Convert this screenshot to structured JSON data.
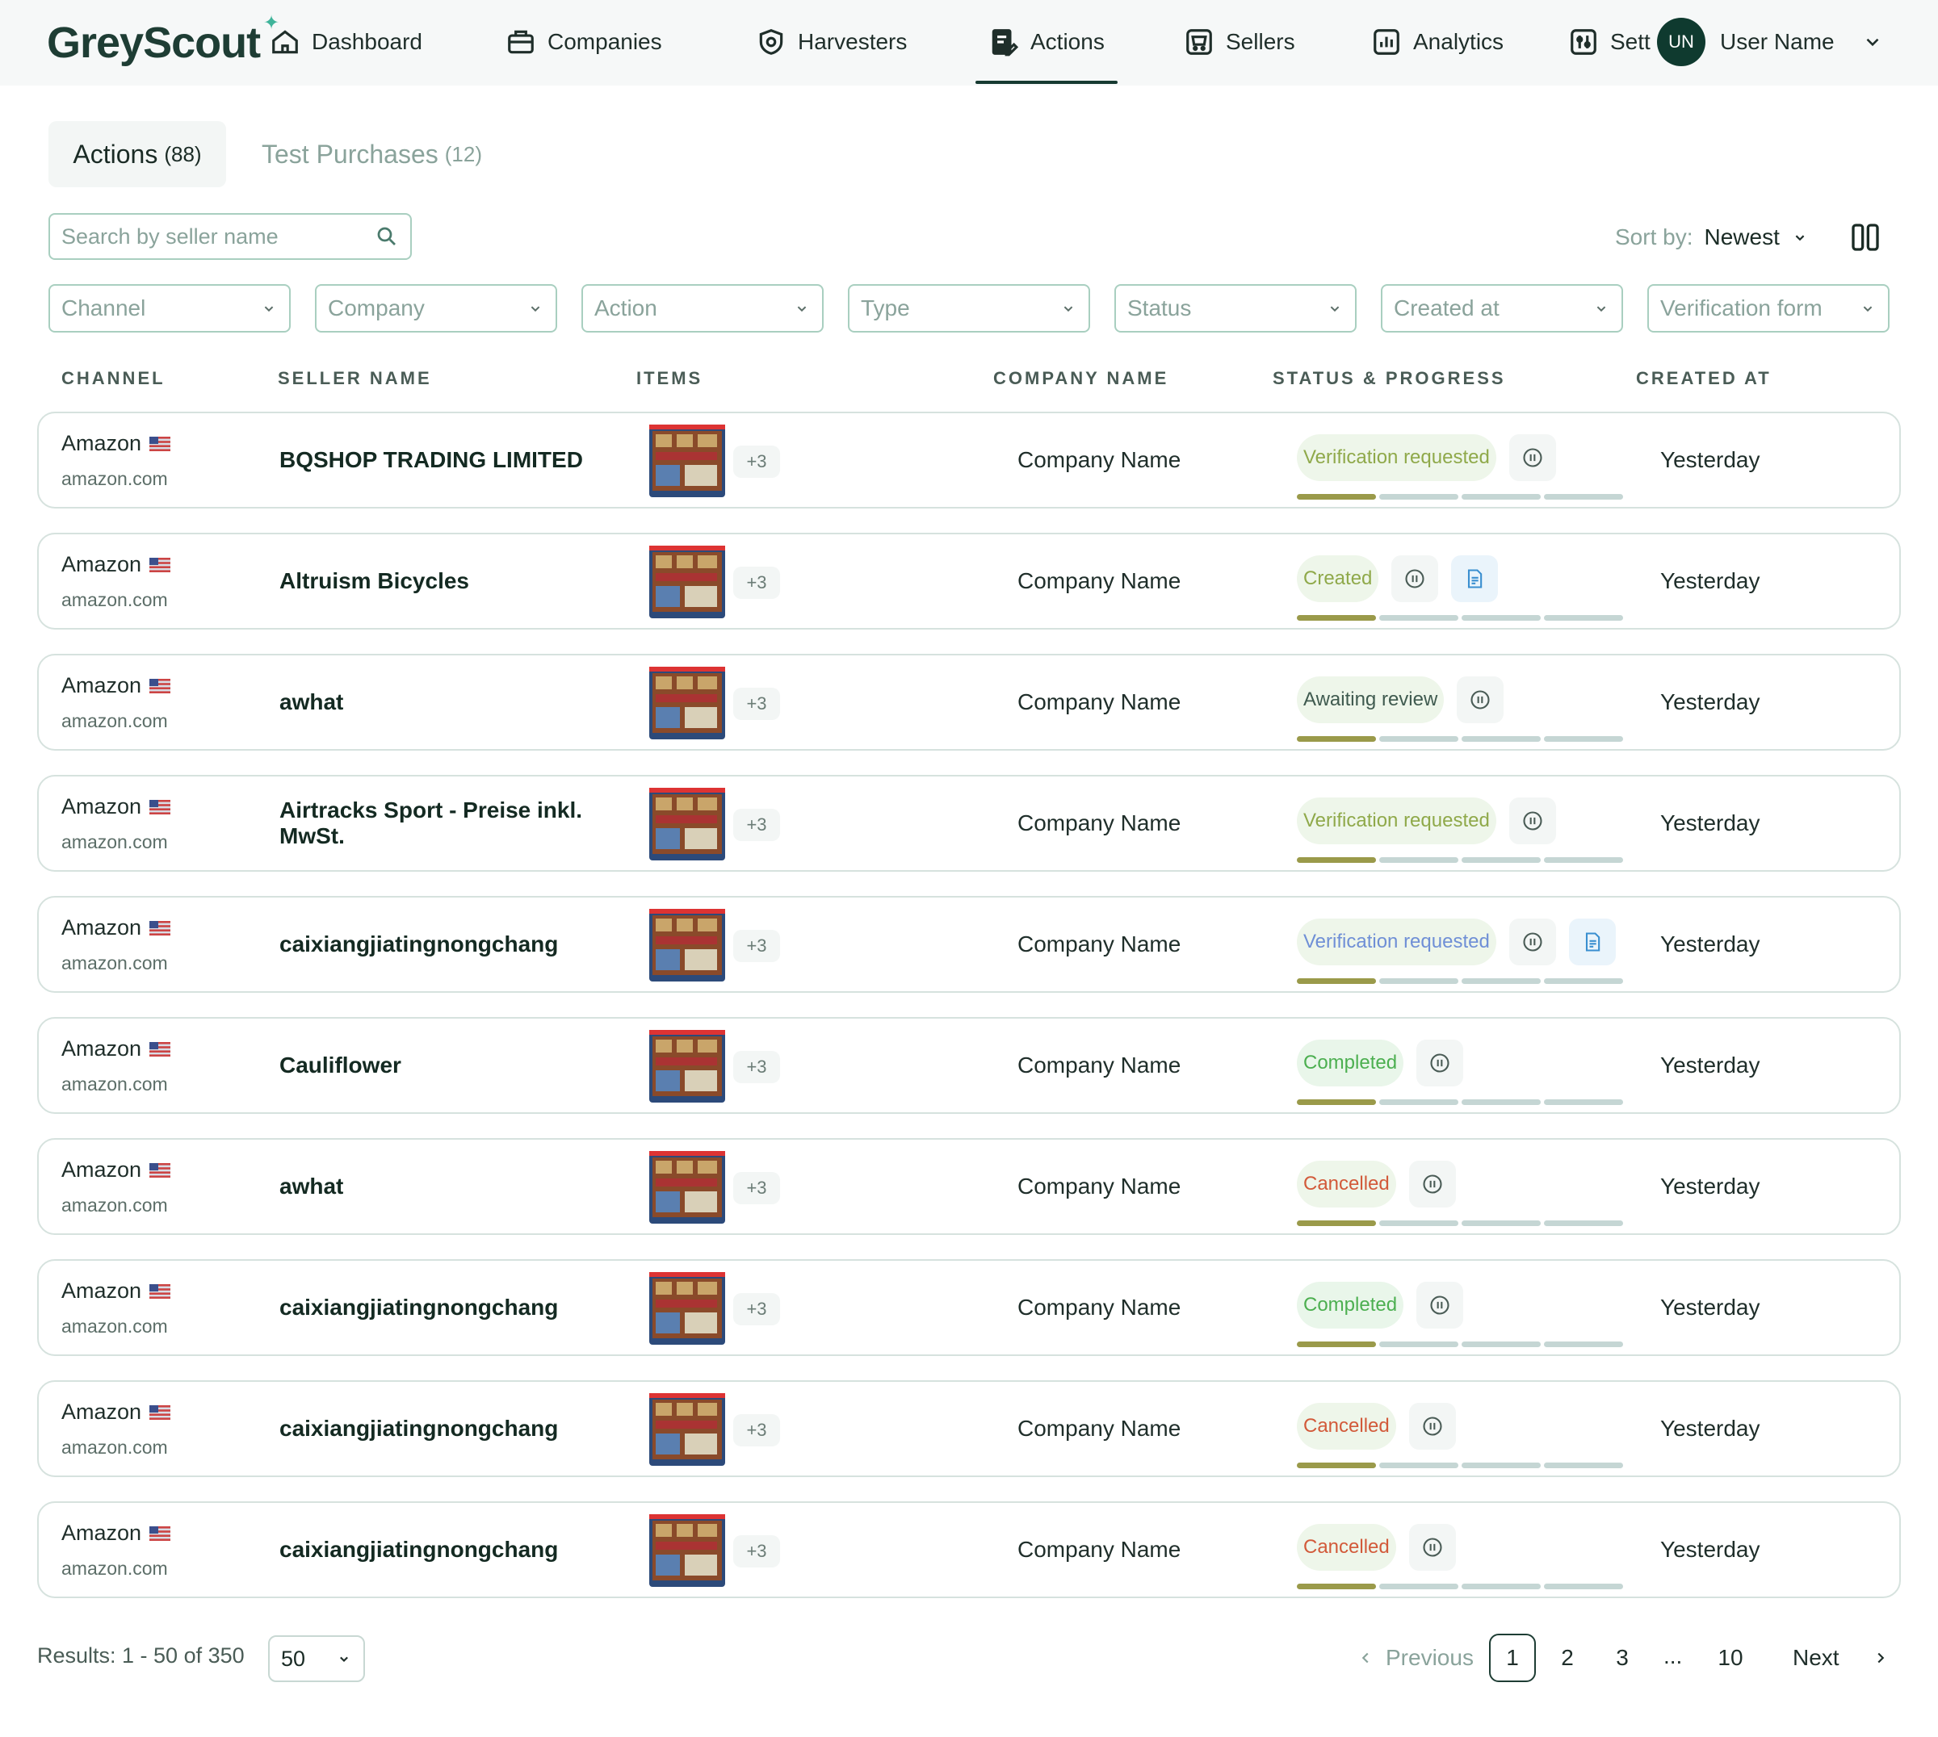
{
  "app": {
    "logo": "GreyScout",
    "nav": [
      {
        "label": "Dashboard",
        "icon": "home-icon"
      },
      {
        "label": "Companies",
        "icon": "briefcase-icon"
      },
      {
        "label": "Harvesters",
        "icon": "shield-gear-icon"
      },
      {
        "label": "Actions",
        "icon": "document-edit-icon",
        "active": true
      },
      {
        "label": "Sellers",
        "icon": "cart-icon"
      },
      {
        "label": "Analytics",
        "icon": "bar-chart-icon"
      },
      {
        "label": "Sett",
        "icon": "sliders-icon"
      }
    ],
    "user": {
      "initials": "UN",
      "name": "User Name"
    }
  },
  "tabs": [
    {
      "label": "Actions",
      "count": "(88)",
      "active": true
    },
    {
      "label": "Test Purchases",
      "count": "(12)",
      "active": false
    }
  ],
  "search": {
    "placeholder": "Search by seller name"
  },
  "sort": {
    "label": "Sort by:",
    "value": "Newest"
  },
  "filters": [
    "Channel",
    "Company",
    "Action",
    "Type",
    "Status",
    "Created at",
    "Verification form"
  ],
  "columns": [
    "CHANNEL",
    "SELLER NAME",
    "ITEMS",
    "COMPANY NAME",
    "STATUS & PROGRESS",
    "CREATED AT"
  ],
  "rows": [
    {
      "channel": "Amazon",
      "domain": "amazon.com",
      "seller": "BQSHOP TRADING LIMITED",
      "more": "+3",
      "company": "Company Name",
      "status": "Verification requested",
      "status_tone": "green",
      "has_doc": false,
      "progress": 0.25,
      "created": "Yesterday"
    },
    {
      "channel": "Amazon",
      "domain": "amazon.com",
      "seller": "Altruism Bicycles",
      "more": "+3",
      "company": "Company Name",
      "status": "Created",
      "status_tone": "green",
      "has_doc": true,
      "progress": 0.25,
      "created": "Yesterday"
    },
    {
      "channel": "Amazon",
      "domain": "amazon.com",
      "seller": "awhat",
      "more": "+3",
      "company": "Company Name",
      "status": "Awaiting review",
      "status_tone": "dark",
      "has_doc": false,
      "progress": 0.25,
      "created": "Yesterday"
    },
    {
      "channel": "Amazon",
      "domain": "amazon.com",
      "seller": "Airtracks Sport - Preise inkl. MwSt.",
      "more": "+3",
      "company": "Company Name",
      "status": "Verification requested",
      "status_tone": "green",
      "has_doc": false,
      "progress": 0.25,
      "created": "Yesterday"
    },
    {
      "channel": "Amazon",
      "domain": "amazon.com",
      "seller": "caixiangjiatingnongchang",
      "more": "+3",
      "company": "Company Name",
      "status": "Verification requested",
      "status_tone": "blue",
      "has_doc": true,
      "progress": 0.25,
      "created": "Yesterday"
    },
    {
      "channel": "Amazon",
      "domain": "amazon.com",
      "seller": "Cauliflower",
      "more": "+3",
      "company": "Company Name",
      "status": "Completed",
      "status_tone": "greenok",
      "has_doc": false,
      "progress": 0.25,
      "created": "Yesterday"
    },
    {
      "channel": "Amazon",
      "domain": "amazon.com",
      "seller": "awhat",
      "more": "+3",
      "company": "Company Name",
      "status": "Cancelled",
      "status_tone": "red",
      "has_doc": false,
      "progress": 0.25,
      "created": "Yesterday"
    },
    {
      "channel": "Amazon",
      "domain": "amazon.com",
      "seller": "caixiangjiatingnongchang",
      "more": "+3",
      "company": "Company Name",
      "status": "Completed",
      "status_tone": "greenok",
      "has_doc": false,
      "progress": 0.25,
      "created": "Yesterday"
    },
    {
      "channel": "Amazon",
      "domain": "amazon.com",
      "seller": "caixiangjiatingnongchang",
      "more": "+3",
      "company": "Company Name",
      "status": "Cancelled",
      "status_tone": "red",
      "has_doc": false,
      "progress": 0.25,
      "created": "Yesterday"
    },
    {
      "channel": "Amazon",
      "domain": "amazon.com",
      "seller": "caixiangjiatingnongchang",
      "more": "+3",
      "company": "Company Name",
      "status": "Cancelled",
      "status_tone": "red",
      "has_doc": false,
      "progress": 0.25,
      "created": "Yesterday"
    }
  ],
  "footer": {
    "results": "Results: 1 - 50 of 350",
    "per_page": "50",
    "prev": "Previous",
    "next": "Next",
    "pages": [
      "1",
      "2",
      "3",
      "10"
    ],
    "ellipsis": "...",
    "current_page": "1"
  },
  "colors": {
    "brand": "#1e3d34",
    "accent": "#3fb49a",
    "border": "#a9cfc0",
    "progress_done": "#9a9a4a",
    "progress_todo": "#c5d6d4"
  }
}
